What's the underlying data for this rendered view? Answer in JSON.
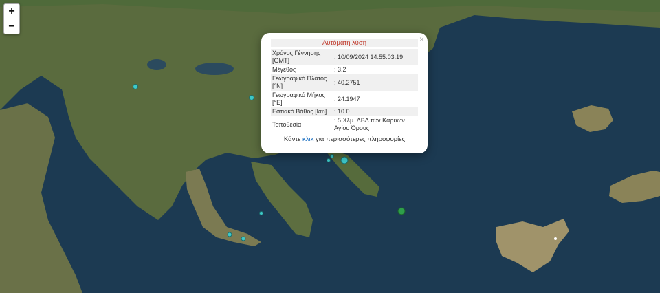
{
  "zoom": {
    "in_label": "+",
    "out_label": "−"
  },
  "colors": {
    "sea": "#1c3a52",
    "land": "#5a6b3e",
    "quake_marker": "#3ec9c9",
    "epicenter_marker": "#2e9e4a",
    "popup_title": "#c0392b",
    "link": "#1a6fc2"
  },
  "popup": {
    "title": "Αυτόματη λύση",
    "close": "×",
    "rows": [
      {
        "label": "Χρόνος Γέννησης [GMT]",
        "value": ": 10/09/2024 14:55:03.19"
      },
      {
        "label": "Μέγεθος",
        "value": ": 3.2"
      },
      {
        "label": "Γεωγραφικό Πλάτος [°N]",
        "value": ": 40.2751"
      },
      {
        "label": "Γεωγραφικό Μήκος [°E]",
        "value": ": 24.1947"
      },
      {
        "label": "Εστιακό Βάθος [km]",
        "value": ": 10.0"
      },
      {
        "label": "Τοποθεσία",
        "value": ": 5 Χλμ. ΔΒΔ των Καρυών Αγίου Όρους"
      }
    ],
    "footer_before": "Κάντε ",
    "footer_link": "κλικ",
    "footer_after": " για περισσότερες πληροφορίες"
  }
}
